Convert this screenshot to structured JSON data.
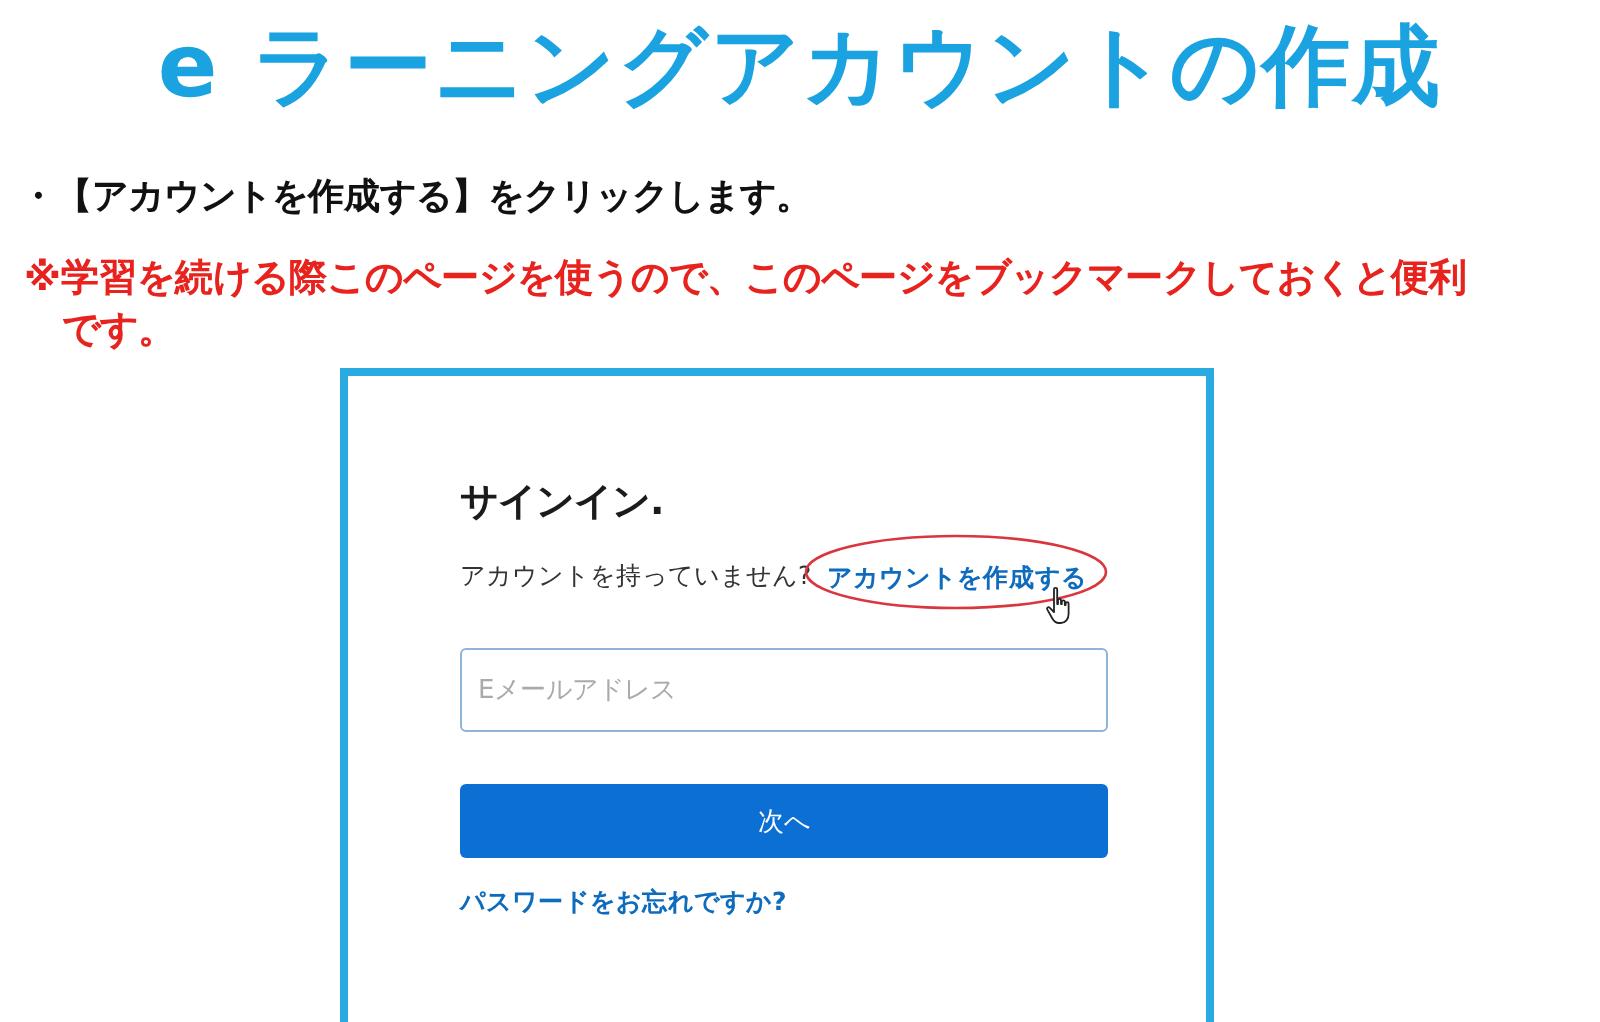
{
  "slide_title": "e ラーニングアカウントの作成",
  "bullet": "・【アカウントを作成する】をクリックします。",
  "note": "※学習を続ける際このページを使うので、このページをブックマークしておくと便利です。",
  "signin": {
    "title": "サインイン.",
    "prompt": "アカウントを持っていません?",
    "create_link": "アカウントを作成する",
    "email": {
      "placeholder": "Eメールアドレス"
    },
    "next_button": "次へ",
    "forgot_link": "パスワードをお忘れですか?"
  }
}
